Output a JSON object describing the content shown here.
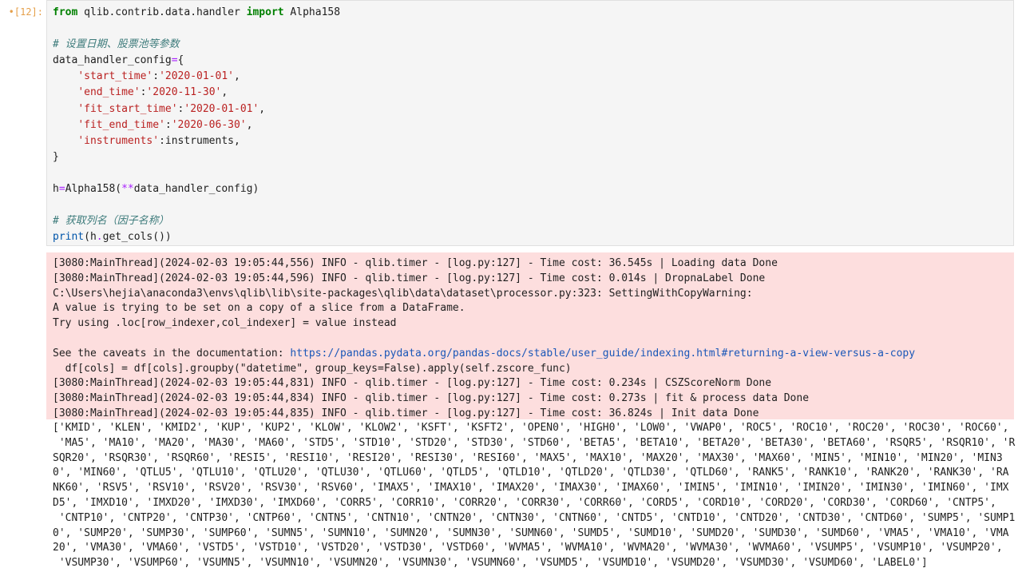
{
  "cell": {
    "prompt": "•[12]:",
    "code_lines": [
      [
        {
          "t": "kw",
          "v": "from"
        },
        {
          "t": "",
          "v": " qlib.contrib.data.handler "
        },
        {
          "t": "kw",
          "v": "import"
        },
        {
          "t": "",
          "v": " Alpha158"
        }
      ],
      [],
      [
        {
          "t": "cm",
          "v": "# 设置日期、股票池等参数"
        }
      ],
      [
        {
          "t": "",
          "v": "data_handler_config"
        },
        {
          "t": "op",
          "v": "="
        },
        {
          "t": "",
          "v": "{"
        }
      ],
      [
        {
          "t": "",
          "v": "    "
        },
        {
          "t": "str",
          "v": "'start_time'"
        },
        {
          "t": "",
          "v": ":"
        },
        {
          "t": "str",
          "v": "'2020-01-01'"
        },
        {
          "t": "",
          "v": ","
        }
      ],
      [
        {
          "t": "",
          "v": "    "
        },
        {
          "t": "str",
          "v": "'end_time'"
        },
        {
          "t": "",
          "v": ":"
        },
        {
          "t": "str",
          "v": "'2020-11-30'"
        },
        {
          "t": "",
          "v": ","
        }
      ],
      [
        {
          "t": "",
          "v": "    "
        },
        {
          "t": "str",
          "v": "'fit_start_time'"
        },
        {
          "t": "",
          "v": ":"
        },
        {
          "t": "str",
          "v": "'2020-01-01'"
        },
        {
          "t": "",
          "v": ","
        }
      ],
      [
        {
          "t": "",
          "v": "    "
        },
        {
          "t": "str",
          "v": "'fit_end_time'"
        },
        {
          "t": "",
          "v": ":"
        },
        {
          "t": "str",
          "v": "'2020-06-30'"
        },
        {
          "t": "",
          "v": ","
        }
      ],
      [
        {
          "t": "",
          "v": "    "
        },
        {
          "t": "str",
          "v": "'instruments'"
        },
        {
          "t": "",
          "v": ":instruments,"
        }
      ],
      [
        {
          "t": "",
          "v": "}"
        }
      ],
      [],
      [
        {
          "t": "",
          "v": "h"
        },
        {
          "t": "op",
          "v": "="
        },
        {
          "t": "",
          "v": "Alpha158("
        },
        {
          "t": "op",
          "v": "**"
        },
        {
          "t": "",
          "v": "data_handler_config)"
        }
      ],
      [],
      [
        {
          "t": "cm",
          "v": "# 获取列名（因子名称）"
        }
      ],
      [
        {
          "t": "fn",
          "v": "print"
        },
        {
          "t": "",
          "v": "(h"
        },
        {
          "t": "op",
          "v": "."
        },
        {
          "t": "",
          "v": "get_cols())"
        }
      ]
    ]
  },
  "stderr": {
    "lines": [
      [
        {
          "t": "",
          "v": "[3080:MainThread](2024-02-03 19:05:44,556) INFO - qlib.timer - [log.py:127] - Time cost: 36.545s | Loading data Done"
        }
      ],
      [
        {
          "t": "",
          "v": "[3080:MainThread](2024-02-03 19:05:44,596) INFO - qlib.timer - [log.py:127] - Time cost: 0.014s | DropnaLabel Done"
        }
      ],
      [
        {
          "t": "",
          "v": "C:\\Users\\hejia\\anaconda3\\envs\\qlib\\lib\\site-packages\\qlib\\data\\dataset\\processor.py:323: SettingWithCopyWarning:"
        }
      ],
      [
        {
          "t": "",
          "v": "A value is trying to be set on a copy of a slice from a DataFrame."
        }
      ],
      [
        {
          "t": "",
          "v": "Try using .loc[row_indexer,col_indexer] = value instead"
        }
      ],
      [],
      [
        {
          "t": "",
          "v": "See the caveats in the documentation: "
        },
        {
          "t": "link",
          "v": "https://pandas.pydata.org/pandas-docs/stable/user_guide/indexing.html#returning-a-view-versus-a-copy"
        }
      ],
      [
        {
          "t": "",
          "v": "  df[cols] = df[cols].groupby(\"datetime\", group_keys=False).apply(self.zscore_func)"
        }
      ],
      [
        {
          "t": "",
          "v": "[3080:MainThread](2024-02-03 19:05:44,831) INFO - qlib.timer - [log.py:127] - Time cost: 0.234s | CSZScoreNorm Done"
        }
      ],
      [
        {
          "t": "",
          "v": "[3080:MainThread](2024-02-03 19:05:44,834) INFO - qlib.timer - [log.py:127] - Time cost: 0.273s | fit & process data Done"
        }
      ],
      [
        {
          "t": "",
          "v": "[3080:MainThread](2024-02-03 19:05:44,835) INFO - qlib.timer - [log.py:127] - Time cost: 36.824s | Init data Done"
        }
      ]
    ]
  },
  "stdout": {
    "lines": [
      "['KMID', 'KLEN', 'KMID2', 'KUP', 'KUP2', 'KLOW', 'KLOW2', 'KSFT', 'KSFT2', 'OPEN0', 'HIGH0', 'LOW0', 'VWAP0', 'ROC5', 'ROC10', 'ROC20', 'ROC30', 'ROC60',",
      " 'MA5', 'MA10', 'MA20', 'MA30', 'MA60', 'STD5', 'STD10', 'STD20', 'STD30', 'STD60', 'BETA5', 'BETA10', 'BETA20', 'BETA30', 'BETA60', 'RSQR5', 'RSQR10', 'R",
      "SQR20', 'RSQR30', 'RSQR60', 'RESI5', 'RESI10', 'RESI20', 'RESI30', 'RESI60', 'MAX5', 'MAX10', 'MAX20', 'MAX30', 'MAX60', 'MIN5', 'MIN10', 'MIN20', 'MIN3",
      "0', 'MIN60', 'QTLU5', 'QTLU10', 'QTLU20', 'QTLU30', 'QTLU60', 'QTLD5', 'QTLD10', 'QTLD20', 'QTLD30', 'QTLD60', 'RANK5', 'RANK10', 'RANK20', 'RANK30', 'RA",
      "NK60', 'RSV5', 'RSV10', 'RSV20', 'RSV30', 'RSV60', 'IMAX5', 'IMAX10', 'IMAX20', 'IMAX30', 'IMAX60', 'IMIN5', 'IMIN10', 'IMIN20', 'IMIN30', 'IMIN60', 'IMX",
      "D5', 'IMXD10', 'IMXD20', 'IMXD30', 'IMXD60', 'CORR5', 'CORR10', 'CORR20', 'CORR30', 'CORR60', 'CORD5', 'CORD10', 'CORD20', 'CORD30', 'CORD60', 'CNTP5',",
      " 'CNTP10', 'CNTP20', 'CNTP30', 'CNTP60', 'CNTN5', 'CNTN10', 'CNTN20', 'CNTN30', 'CNTN60', 'CNTD5', 'CNTD10', 'CNTD20', 'CNTD30', 'CNTD60', 'SUMP5', 'SUMP1",
      "0', 'SUMP20', 'SUMP30', 'SUMP60', 'SUMN5', 'SUMN10', 'SUMN20', 'SUMN30', 'SUMN60', 'SUMD5', 'SUMD10', 'SUMD20', 'SUMD30', 'SUMD60', 'VMA5', 'VMA10', 'VMA",
      "20', 'VMA30', 'VMA60', 'VSTD5', 'VSTD10', 'VSTD20', 'VSTD30', 'VSTD60', 'WVMA5', 'WVMA10', 'WVMA20', 'WVMA30', 'WVMA60', 'VSUMP5', 'VSUMP10', 'VSUMP20',",
      " 'VSUMP30', 'VSUMP60', 'VSUMN5', 'VSUMN10', 'VSUMN20', 'VSUMN30', 'VSUMN60', 'VSUMD5', 'VSUMD10', 'VSUMD20', 'VSUMD30', 'VSUMD60', 'LABEL0']"
    ]
  }
}
